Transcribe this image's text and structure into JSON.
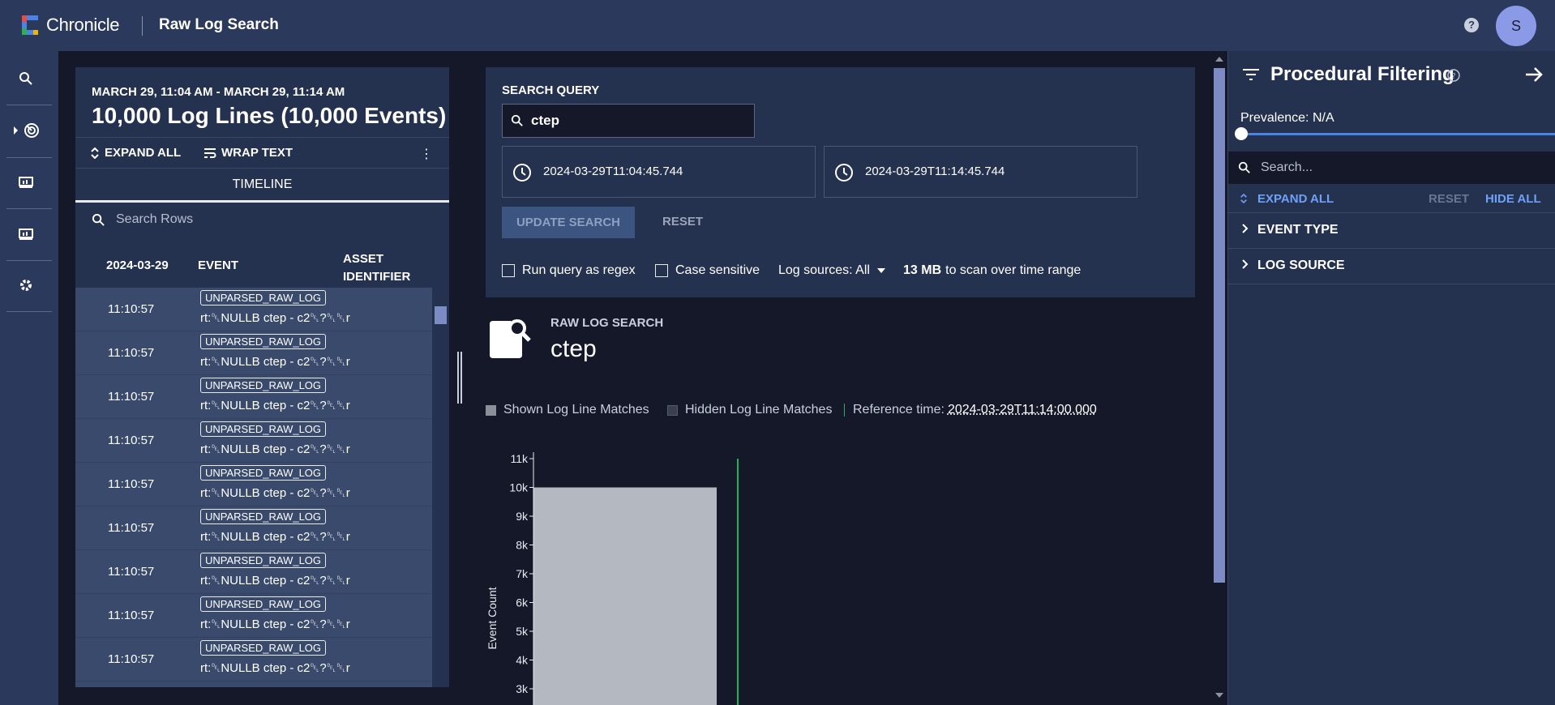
{
  "app": {
    "brand": "Chronicle",
    "title": "Raw Log Search",
    "help": "?",
    "avatar_letter": "S"
  },
  "results": {
    "time_range": "MARCH 29, 11:04 AM - MARCH 29, 11:14 AM",
    "count_title": "10,000 Log Lines (10,000 Events)",
    "expand_all": "EXPAND ALL",
    "wrap_text": "WRAP TEXT",
    "tab": "TIMELINE",
    "search_placeholder": "Search Rows",
    "columns": [
      "2024-03-29",
      "EVENT",
      "ASSET",
      "IDENTIFIER"
    ],
    "rows": [
      {
        "time": "11:10:57",
        "tag": "UNPARSED_RAW_LOG",
        "raw": "rt:␡NULLB ctep - c2␡?␡␡r"
      },
      {
        "time": "11:10:57",
        "tag": "UNPARSED_RAW_LOG",
        "raw": "rt:␡NULLB ctep - c2␡?␡␡r"
      },
      {
        "time": "11:10:57",
        "tag": "UNPARSED_RAW_LOG",
        "raw": "rt:␡NULLB ctep - c2␡?␡␡r"
      },
      {
        "time": "11:10:57",
        "tag": "UNPARSED_RAW_LOG",
        "raw": "rt:␡NULLB ctep - c2␡?␡␡r"
      },
      {
        "time": "11:10:57",
        "tag": "UNPARSED_RAW_LOG",
        "raw": "rt:␡NULLB ctep - c2␡?␡␡r"
      },
      {
        "time": "11:10:57",
        "tag": "UNPARSED_RAW_LOG",
        "raw": "rt:␡NULLB ctep - c2␡?␡␡r"
      },
      {
        "time": "11:10:57",
        "tag": "UNPARSED_RAW_LOG",
        "raw": "rt:␡NULLB ctep - c2␡?␡␡r"
      },
      {
        "time": "11:10:57",
        "tag": "UNPARSED_RAW_LOG",
        "raw": "rt:␡NULLB ctep - c2␡?␡␡r"
      },
      {
        "time": "11:10:57",
        "tag": "UNPARSED_RAW_LOG",
        "raw": "rt:␡NULLB ctep - c2␡?␡␡r"
      }
    ]
  },
  "query": {
    "label": "SEARCH QUERY",
    "value": "ctep",
    "start": "2024-03-29T11:04:45.744",
    "end": "2024-03-29T11:14:45.744",
    "update_label": "UPDATE SEARCH",
    "reset_label": "RESET",
    "regex_label": "Run query as regex",
    "case_label": "Case sensitive",
    "sources_label": "Log sources: All",
    "scan_size": "13 MB",
    "scan_text": "to scan over time range"
  },
  "rls": {
    "label": "RAW LOG SEARCH",
    "query": "ctep",
    "legend_shown": "Shown Log Line Matches",
    "legend_hidden": "Hidden Log Line Matches",
    "ref_label": "Reference time:",
    "ref_time": "2024-03-29T11:14:00.000"
  },
  "chart_data": {
    "type": "bar",
    "ylabel": "Event Count",
    "yticks": [
      "3k",
      "4k",
      "5k",
      "6k",
      "7k",
      "8k",
      "9k",
      "10k",
      "11k"
    ],
    "ylim": [
      3000,
      11000
    ],
    "values": [
      10000
    ],
    "colors": {
      "bar": "#b4b8c0",
      "reference": "#1fb45a"
    }
  },
  "filter": {
    "title": "Procedural Filtering",
    "prevalence": "Prevalence: N/A",
    "search_placeholder": "Search...",
    "expand_all": "EXPAND ALL",
    "reset": "RESET",
    "hide_all": "HIDE ALL",
    "groups": [
      "EVENT TYPE",
      "LOG SOURCE"
    ]
  }
}
